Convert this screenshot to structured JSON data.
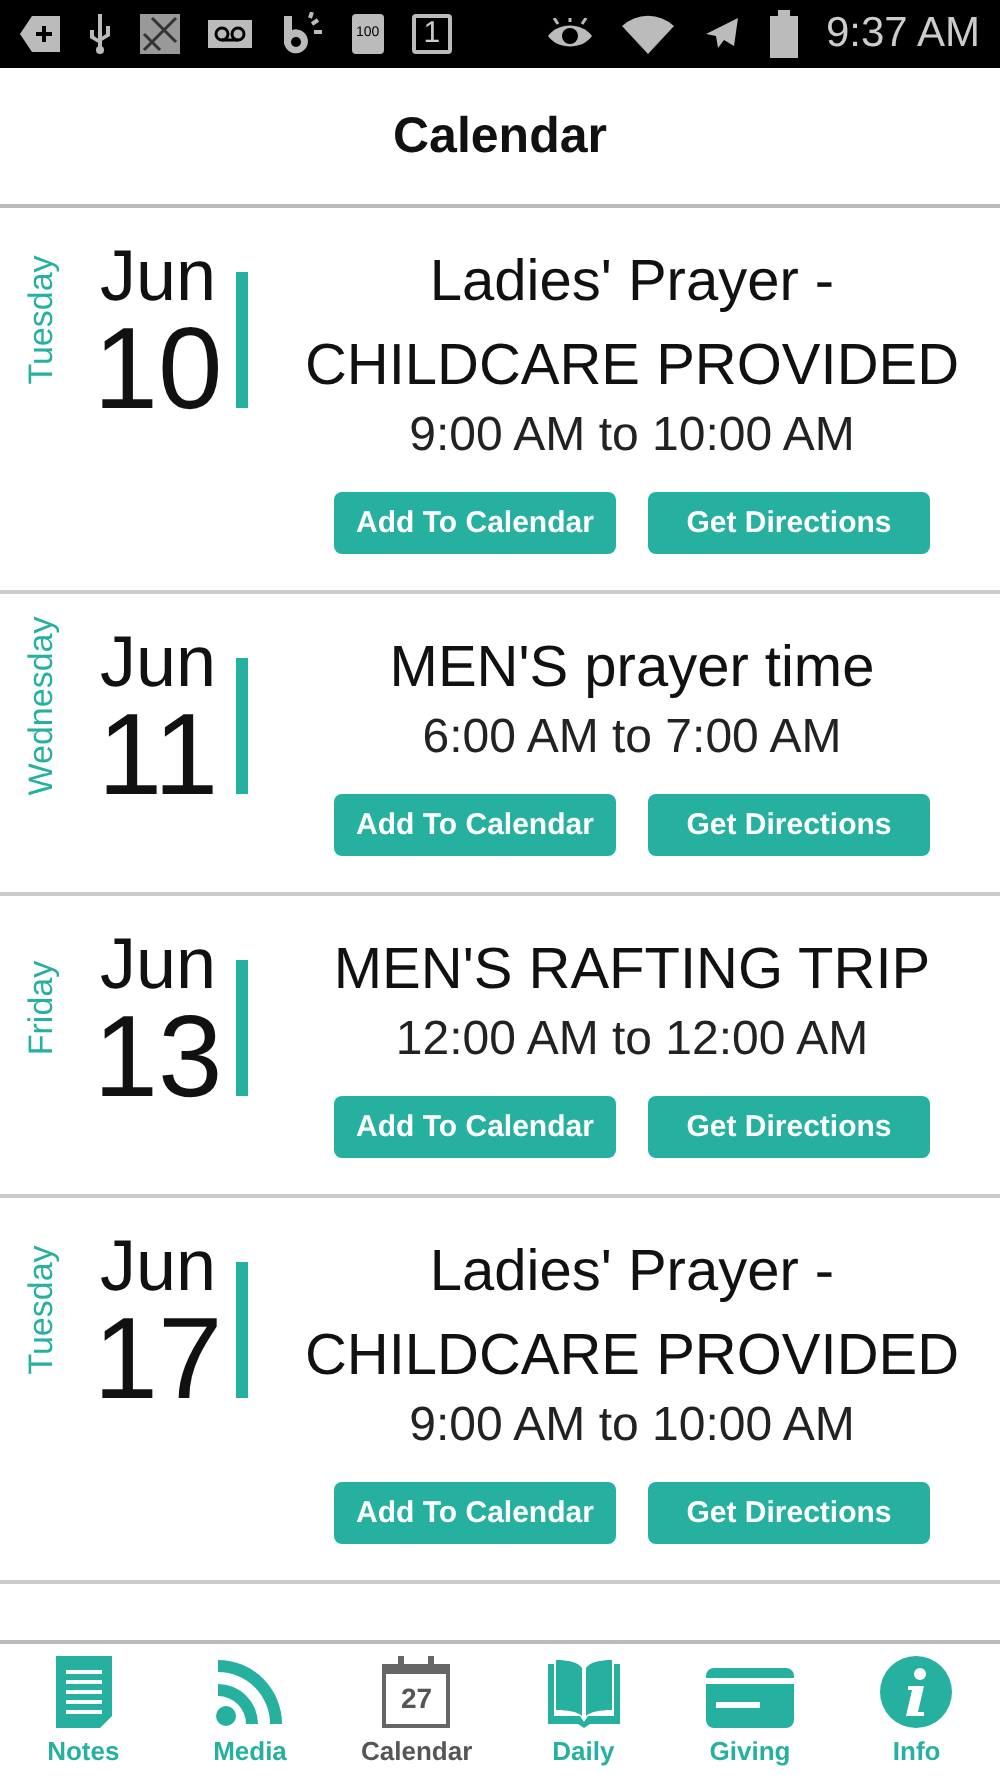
{
  "status_bar": {
    "battery_badge": "100",
    "calendar_badge": "1",
    "time": "9:37 AM"
  },
  "header": {
    "title": "Calendar"
  },
  "events": [
    {
      "weekday": "Tuesday",
      "month": "Jun",
      "day": "10",
      "title": "Ladies' Prayer - CHILDCARE PROVIDED",
      "time": "9:00 AM to 10:00 AM",
      "buttons": [
        "Add To Calendar",
        "Get Directions"
      ]
    },
    {
      "weekday": "Wednesday",
      "month": "Jun",
      "day": "11",
      "title": "MEN'S prayer time",
      "time": "6:00 AM to 7:00 AM",
      "buttons": [
        "Add To Calendar",
        "Get Directions"
      ]
    },
    {
      "weekday": "Friday",
      "month": "Jun",
      "day": "13",
      "title": "MEN'S RAFTING TRIP",
      "time": "12:00 AM to 12:00 AM",
      "buttons": [
        "Add To Calendar",
        "Get Directions"
      ]
    },
    {
      "weekday": "Tuesday",
      "month": "Jun",
      "day": "17",
      "title": "Ladies' Prayer - CHILDCARE PROVIDED",
      "time": "9:00 AM to 10:00 AM",
      "buttons": [
        "Add To Calendar",
        "Get Directions"
      ]
    }
  ],
  "nav": [
    {
      "kind": "notes",
      "label": "Notes",
      "selected": false
    },
    {
      "kind": "media",
      "label": "Media",
      "selected": false
    },
    {
      "kind": "calendar",
      "label": "Calendar",
      "selected": true,
      "badge": "27"
    },
    {
      "kind": "daily",
      "label": "Daily",
      "selected": false
    },
    {
      "kind": "giving",
      "label": "Giving",
      "selected": false
    },
    {
      "kind": "info",
      "label": "Info",
      "selected": false
    }
  ]
}
